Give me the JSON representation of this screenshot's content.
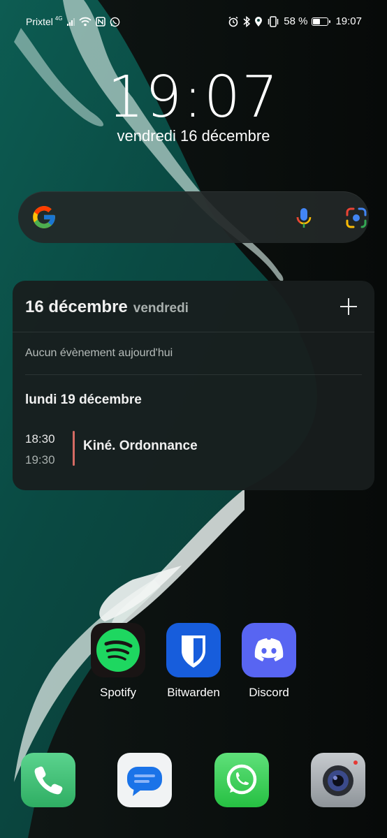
{
  "status_bar": {
    "carrier": "Prixtel",
    "network_type": "4G",
    "battery_percent": "58 %",
    "battery_level": 0.58,
    "time": "19:07",
    "icons": [
      "signal-icon",
      "wifi-icon",
      "nfc-icon",
      "whatsapp-notification-icon",
      "alarm-icon",
      "bluetooth-icon",
      "location-icon",
      "vibrate-icon",
      "battery-icon"
    ]
  },
  "clock": {
    "time": "19:07",
    "date": "vendredi 16 décembre"
  },
  "search_widget": {
    "icons": [
      "google-logo-icon",
      "microphone-icon",
      "google-lens-icon"
    ]
  },
  "calendar_widget": {
    "date": "16 décembre",
    "day": "vendredi",
    "no_events_text": "Aucun évènement aujourd'hui",
    "next_day": "lundi 19 décembre",
    "event": {
      "start": "18:30",
      "end": "19:30",
      "title": "Kiné. Ordonnance",
      "color": "#d46a63"
    }
  },
  "apps": [
    {
      "label": "Spotify",
      "icon": "spotify-icon",
      "color": "#191414"
    },
    {
      "label": "Bitwarden",
      "icon": "bitwarden-icon",
      "color": "#175ddc"
    },
    {
      "label": "Discord",
      "icon": "discord-icon",
      "color": "#5865f2"
    }
  ],
  "dock": [
    {
      "icon": "phone-icon",
      "color": "#3fc57a"
    },
    {
      "icon": "messages-icon",
      "color": "#1a73e8"
    },
    {
      "icon": "whatsapp-icon",
      "color": "#25d366"
    },
    {
      "icon": "camera-icon",
      "color": "#9aa0a6"
    }
  ]
}
